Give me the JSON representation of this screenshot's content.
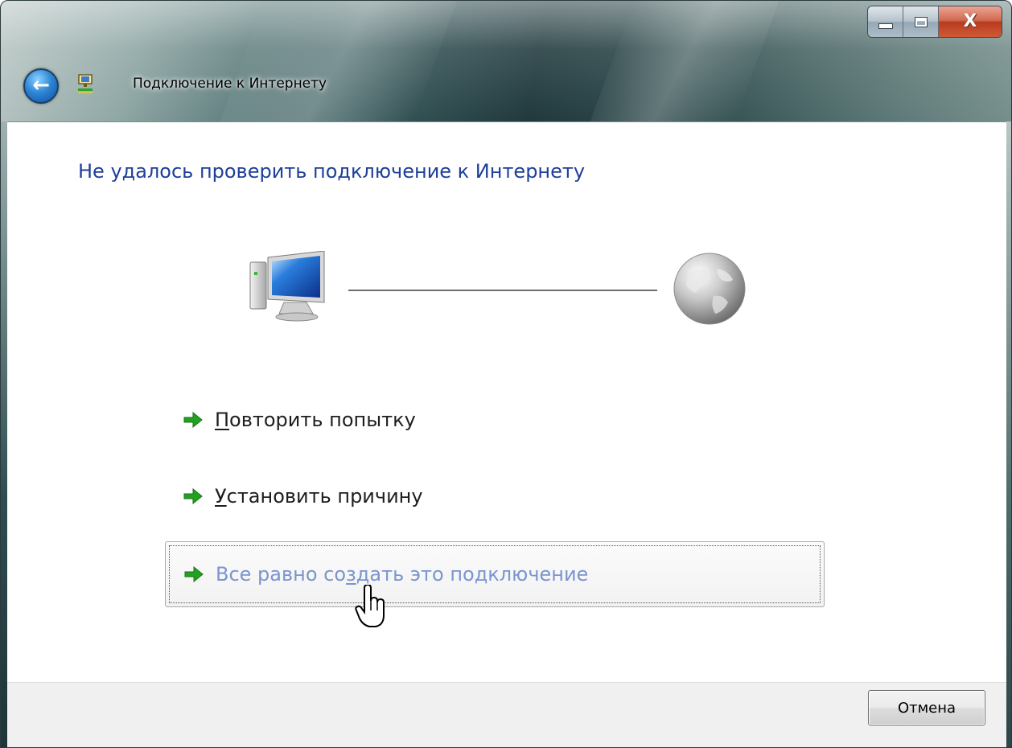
{
  "window": {
    "title": "Подключение к Интернету",
    "caption_buttons": {
      "minimize_icon": "minimize-icon",
      "maximize_icon": "maximize-icon",
      "close_glyph": "X"
    }
  },
  "main": {
    "heading": "Не удалось проверить подключение к Интернету",
    "diagram": {
      "left_icon": "computer-icon",
      "right_icon": "globe-icon"
    },
    "options": [
      {
        "access_key": "П",
        "rest": "овторить попытку",
        "icon": "green-arrow-icon"
      },
      {
        "access_key": "У",
        "rest": "становить причину",
        "icon": "green-arrow-icon"
      },
      {
        "before": "Все равно со",
        "access_key": "з",
        "after": "дать это подключение",
        "icon": "green-arrow-icon",
        "state": "hover"
      }
    ]
  },
  "footer": {
    "cancel_label": "Отмена"
  },
  "colors": {
    "heading": "#1e3f9a",
    "hover_text": "#7a95cf",
    "arrow_green": "#22a31f"
  }
}
